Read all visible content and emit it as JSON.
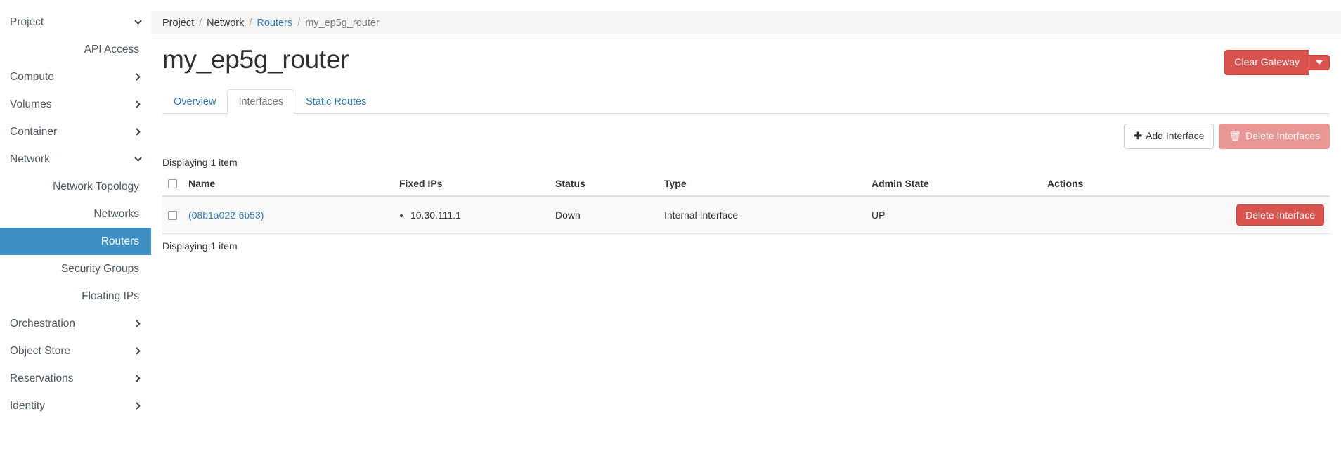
{
  "sidebar": {
    "project_header": {
      "label": "Project",
      "icon": "chevron-down-icon"
    },
    "api_access": {
      "label": "API Access"
    },
    "groups": [
      {
        "label": "Compute",
        "icon": "chevron-right-icon"
      },
      {
        "label": "Volumes",
        "icon": "chevron-right-icon"
      },
      {
        "label": "Container",
        "icon": "chevron-right-icon"
      },
      {
        "label": "Network",
        "icon": "chevron-down-icon"
      }
    ],
    "network_items": [
      {
        "label": "Network Topology",
        "active": false
      },
      {
        "label": "Networks",
        "active": false
      },
      {
        "label": "Routers",
        "active": true
      },
      {
        "label": "Security Groups",
        "active": false
      },
      {
        "label": "Floating IPs",
        "active": false
      }
    ],
    "groups_after": [
      {
        "label": "Orchestration",
        "icon": "chevron-right-icon"
      },
      {
        "label": "Object Store",
        "icon": "chevron-right-icon"
      },
      {
        "label": "Reservations",
        "icon": "chevron-right-icon"
      }
    ],
    "identity": {
      "label": "Identity",
      "icon": "chevron-right-icon"
    },
    "active_color": "#3d8fc4"
  },
  "breadcrumb": {
    "items": [
      {
        "label": "Project",
        "type": "text"
      },
      {
        "label": "Network",
        "type": "text"
      },
      {
        "label": "Routers",
        "type": "link"
      },
      {
        "label": "my_ep5g_router",
        "type": "current"
      }
    ],
    "separator": "/"
  },
  "header": {
    "title": "my_ep5g_router",
    "clear_gateway_label": "Clear Gateway",
    "clear_gateway_caret_icon": "caret-down-icon",
    "danger_color": "#d9534f"
  },
  "tabs": [
    {
      "label": "Overview",
      "active": false
    },
    {
      "label": "Interfaces",
      "active": true
    },
    {
      "label": "Static Routes",
      "active": false
    }
  ],
  "toolbar": {
    "add_interface_label": "Add Interface",
    "add_interface_icon": "plus-icon",
    "delete_interfaces_label": "Delete Interfaces",
    "delete_interfaces_icon": "trash-icon"
  },
  "table": {
    "count_top": "Displaying 1 item",
    "count_bottom": "Displaying 1 item",
    "columns": [
      "Name",
      "Fixed IPs",
      "Status",
      "Type",
      "Admin State",
      "Actions"
    ],
    "rows": [
      {
        "name": "(08b1a022-6b53)",
        "fixed_ips": [
          "10.30.111.1"
        ],
        "status": "Down",
        "type": "Internal Interface",
        "admin_state": "UP",
        "action_label": "Delete Interface"
      }
    ]
  }
}
